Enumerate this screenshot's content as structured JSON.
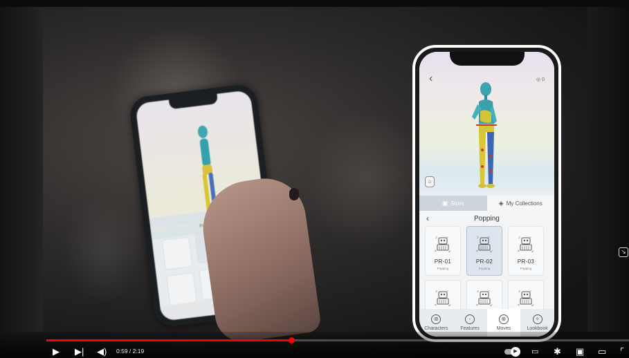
{
  "app": {
    "screen": {
      "tabs": [
        {
          "label": "Store",
          "icon": "store-icon"
        },
        {
          "label": "My Collections",
          "icon": "collections-icon"
        }
      ],
      "section_title": "Popping",
      "cards": [
        {
          "code": "PR-01",
          "sub": "Popping",
          "selected": false
        },
        {
          "code": "PR-02",
          "sub": "Popping",
          "selected": true
        },
        {
          "code": "PR-03",
          "sub": "Popping",
          "selected": false
        },
        {
          "code": "",
          "sub": "",
          "selected": false
        },
        {
          "code": "",
          "sub": "",
          "selected": false
        },
        {
          "code": "",
          "sub": "",
          "selected": false
        }
      ],
      "nav": [
        {
          "label": "Characters",
          "icon": "characters-icon"
        },
        {
          "label": "Features",
          "icon": "features-icon"
        },
        {
          "label": "Moves",
          "icon": "moves-icon",
          "active": true
        },
        {
          "label": "Lookbook",
          "icon": "lookbook-icon"
        }
      ]
    }
  },
  "player": {
    "time": "0:59 / 2:19",
    "progress_fraction": 0.42,
    "icons": [
      "play-icon",
      "next-icon",
      "volume-icon",
      "autoplay-toggle",
      "subtitles-icon",
      "settings-icon",
      "miniplayer-icon",
      "theater-icon",
      "fullscreen-icon"
    ]
  },
  "colors": {
    "accent": "#ff0000",
    "phone_frame": "#ffffff"
  }
}
